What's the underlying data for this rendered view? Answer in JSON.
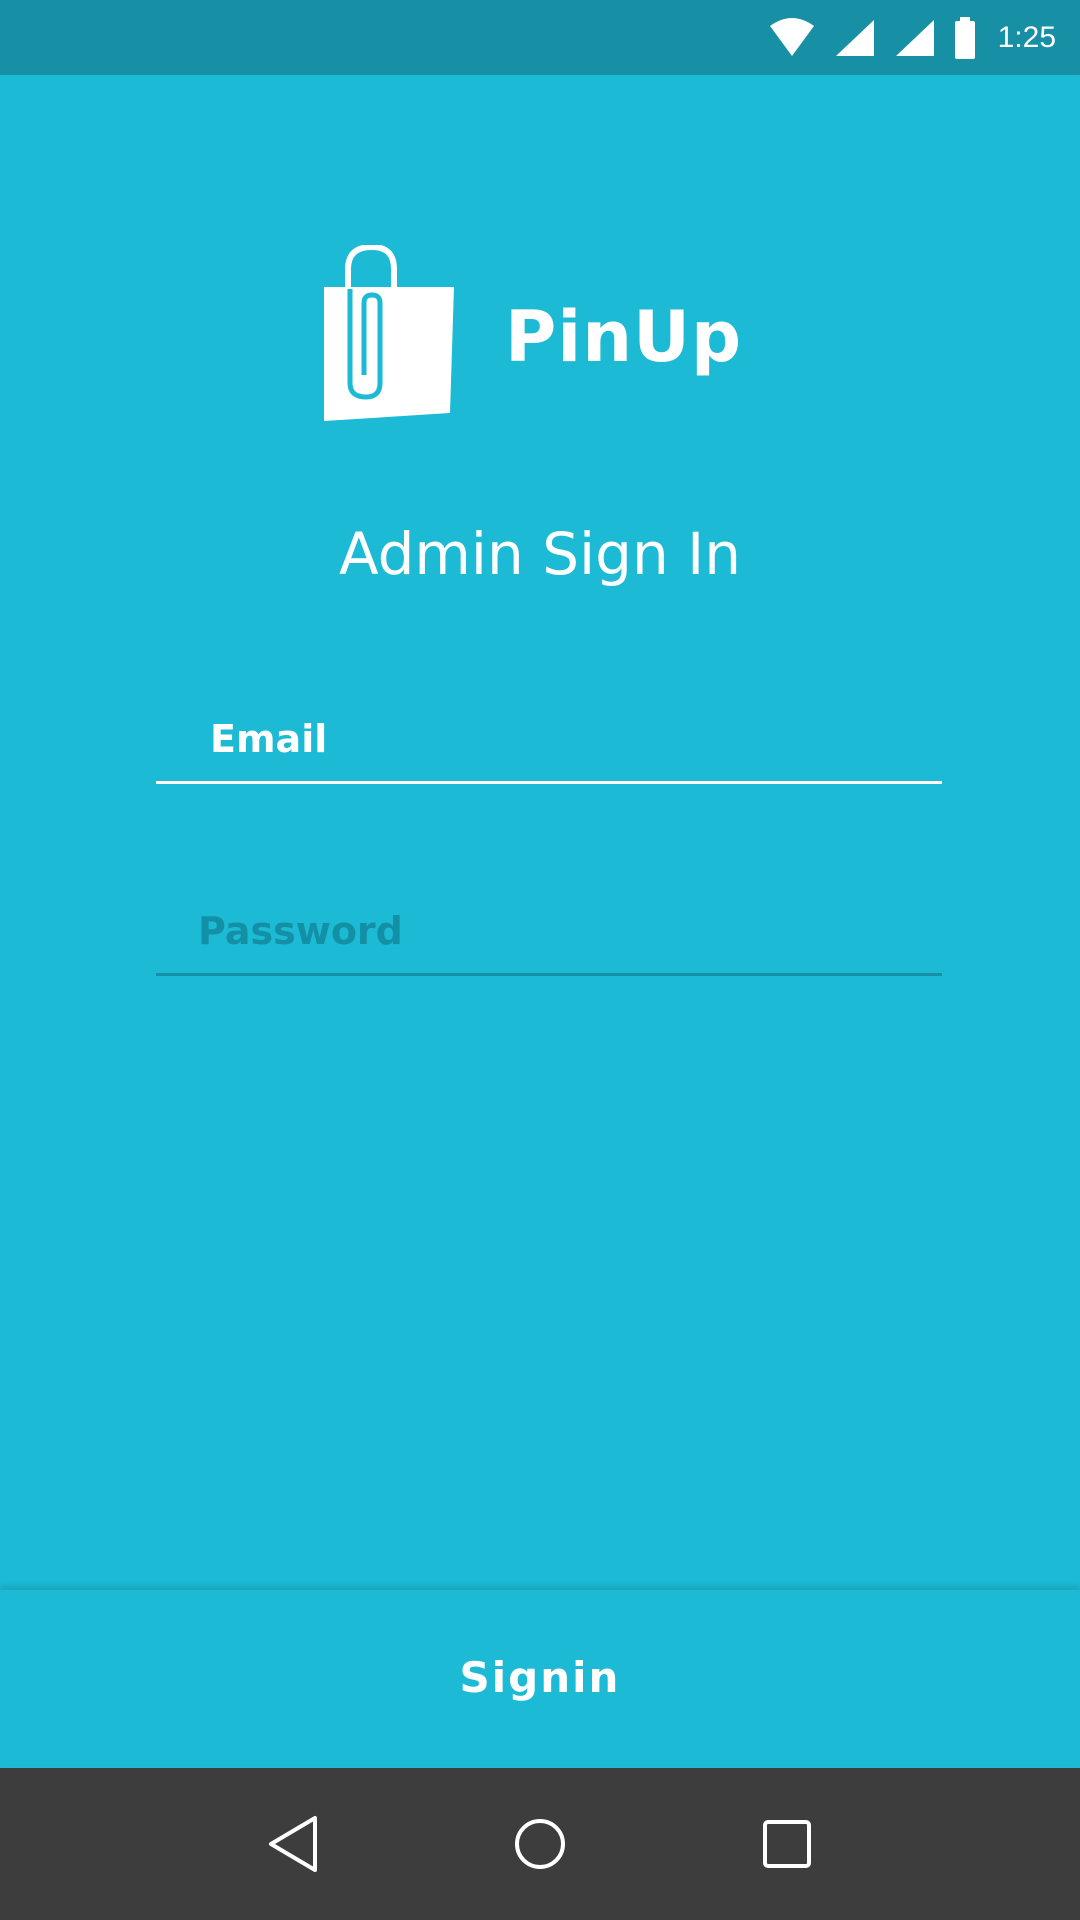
{
  "status_bar": {
    "time": "1:25",
    "icons": [
      "wifi-icon",
      "signal-icon",
      "signal-icon",
      "battery-icon"
    ]
  },
  "app": {
    "name": "PinUp",
    "logo_icon": "shopping-bag-paperclip-icon"
  },
  "page": {
    "title": "Admin Sign In"
  },
  "form": {
    "email_placeholder": "Email",
    "password_placeholder": "Password"
  },
  "actions": {
    "signin_label": "Signin"
  },
  "nav_bar": {
    "icons": [
      "back-icon",
      "home-icon",
      "recents-icon"
    ]
  },
  "colors": {
    "background": "#1cbad4",
    "status_bar": "#178fa5",
    "nav_bar": "#3d3d3d",
    "text": "#ffffff",
    "placeholder_dim": "#1490a6"
  }
}
